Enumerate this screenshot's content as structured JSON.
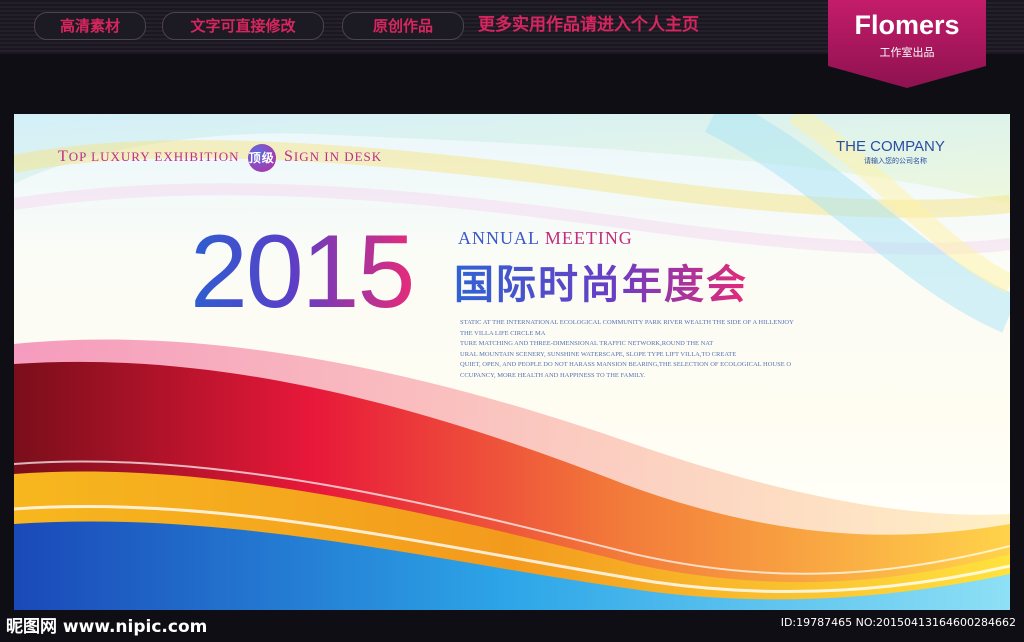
{
  "top_nav": {
    "pills": [
      "高清素材",
      "文字可直接修改",
      "原创作品"
    ],
    "link": "更多实用作品请进入个人主页"
  },
  "brand": {
    "name": "Flomers",
    "subtitle": "工作室出品"
  },
  "banner": {
    "tagline_top_big": "T",
    "tagline_top": "OP LUXURY EXHIBITION",
    "badge": "顶级",
    "tagline_sign_big": "S",
    "tagline_sign": "IGN IN DESK",
    "company": "THE COMPANY",
    "company_sub": "请输入您的公司名称",
    "year": "2015",
    "annual": "ANNUAL",
    "meeting": "MEETING",
    "title_cn": "国际时尚年度会",
    "description": [
      "STATIC AT THE INTERNATIONAL ECOLOGICAL COMMUNITY PARK RIVER WEALTH THE SIDE OF A HILLENJOY",
      "THE VILLA LIFE CIRCLE MA",
      "TURE MATCHING AND THREE-DIMENSIONAL TRAFFIC NETWORK,ROUND THE NAT",
      "URAL MOUNTAIN SCENERY, SUNSHINE WATERSCAPE, SLOPE TYPE LIFT VILLA,TO CREATE",
      "QUIET, OPEN, AND PEOPLE DO NOT HARASS MANSION BEARING,THE SELECTION OF ECOLOGICAL HOUSE O",
      "CCUPANCY, MORE HEALTH AND HAPPINESS TO THE FAMILY."
    ]
  },
  "footer": {
    "site": "昵图网 www.nipic.com",
    "id": "ID:19787465 NO:20150413164600284662"
  },
  "colors": {
    "accent_pink": "#d7265f",
    "brand_bg": "#b3175e",
    "title_blue": "#2d5fd0",
    "title_magenta": "#e62b7a"
  }
}
